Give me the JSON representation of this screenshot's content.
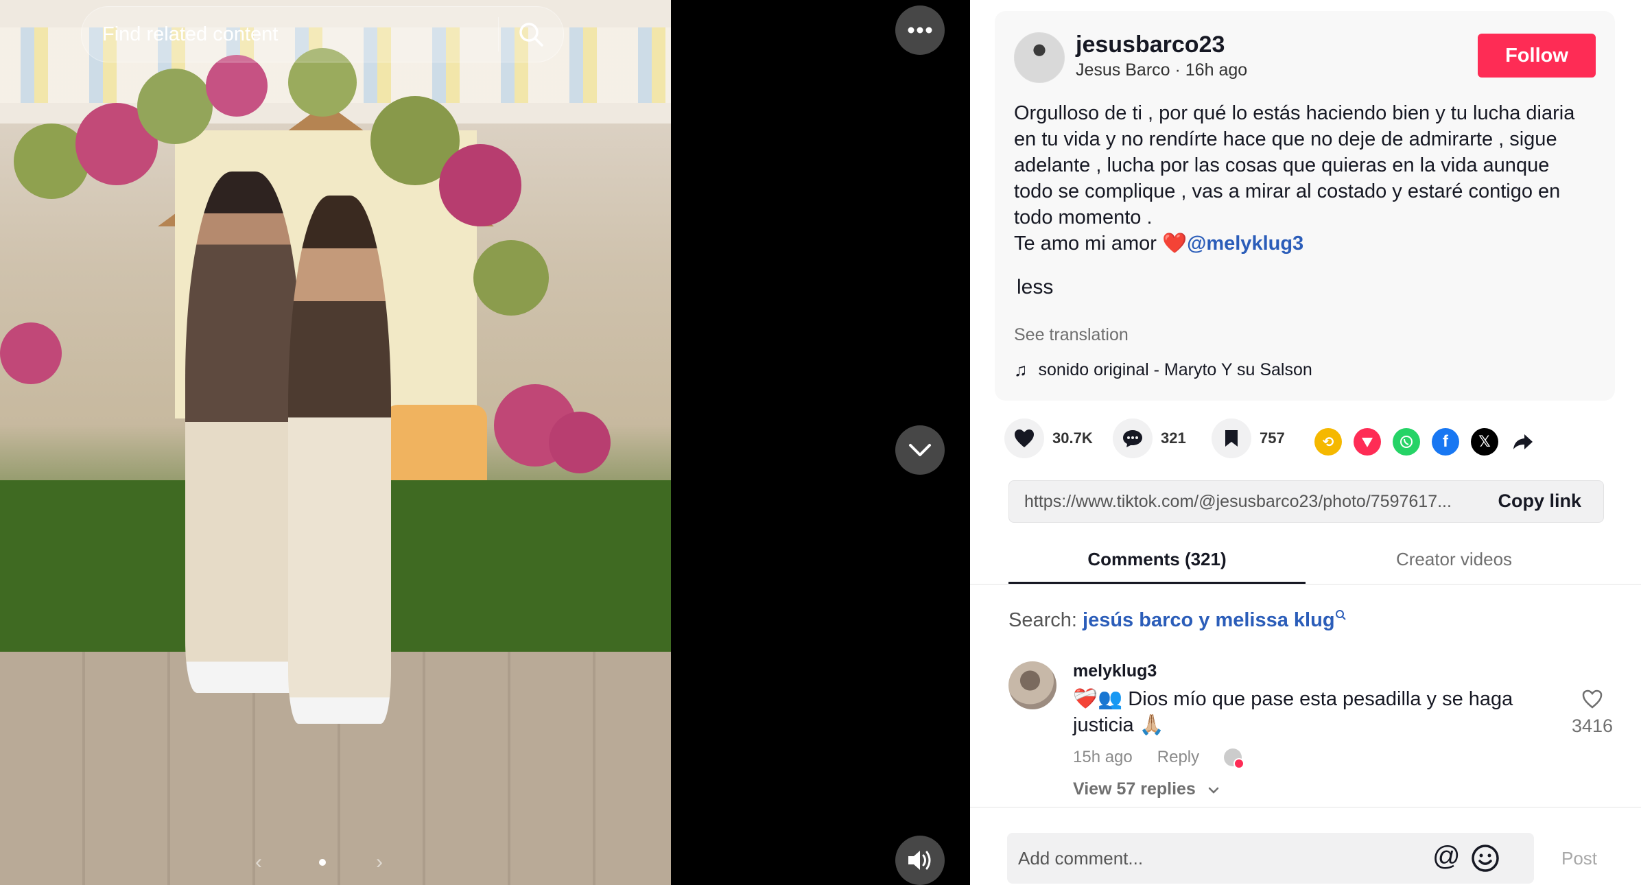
{
  "media": {
    "search_placeholder": "Find related content",
    "carousel_prev": "‹",
    "carousel_next": "›"
  },
  "post": {
    "username": "jesusbarco23",
    "display_name": "Jesus Barco",
    "time_ago": "16h ago",
    "follow_label": "Follow",
    "description_lines": [
      "Orgulloso de ti , por qué lo estás haciendo bien y tu lucha diaria",
      "en tu vida y no rendírte hace que no deje de admirarte , sigue",
      "adelante , lucha por las cosas que quieras en la vida aunque",
      "todo se complique , vas a mirar al costado y estaré contigo en",
      "todo momento ."
    ],
    "love_line_prefix": "Te amo mi amor ❤️",
    "mention": "@melyklug3",
    "less_label": "less",
    "see_translation": "See translation",
    "sound": "sonido original - Maryto Y su Salson"
  },
  "stats": {
    "likes": "30.7K",
    "comments": "321",
    "saves": "757"
  },
  "share": {
    "url": "https://www.tiktok.com/@jesusbarco23/photo/7597617...",
    "copy_label": "Copy link",
    "colors": {
      "repost": "#f5b800",
      "send": "#fe2c55",
      "whatsapp": "#25d366",
      "facebook": "#1877f2",
      "x": "#000000"
    }
  },
  "tabs": {
    "comments": "Comments (321)",
    "creator_videos": "Creator videos"
  },
  "search_suggestion": {
    "prefix": "Search:",
    "query": "jesús barco y melissa klug"
  },
  "comments": [
    {
      "username": "melyklug3",
      "text": "❤️‍🩹👥 Dios mío que pase esta pesadilla y se haga justicia 🙏🏼",
      "time_ago": "15h ago",
      "reply_label": "Reply",
      "like_count": "3416",
      "view_replies": "View 57 replies"
    }
  ],
  "composer": {
    "placeholder": "Add comment...",
    "post_label": "Post"
  },
  "colors": {
    "accent": "#fe2c55",
    "mention": "#2b5db9"
  }
}
